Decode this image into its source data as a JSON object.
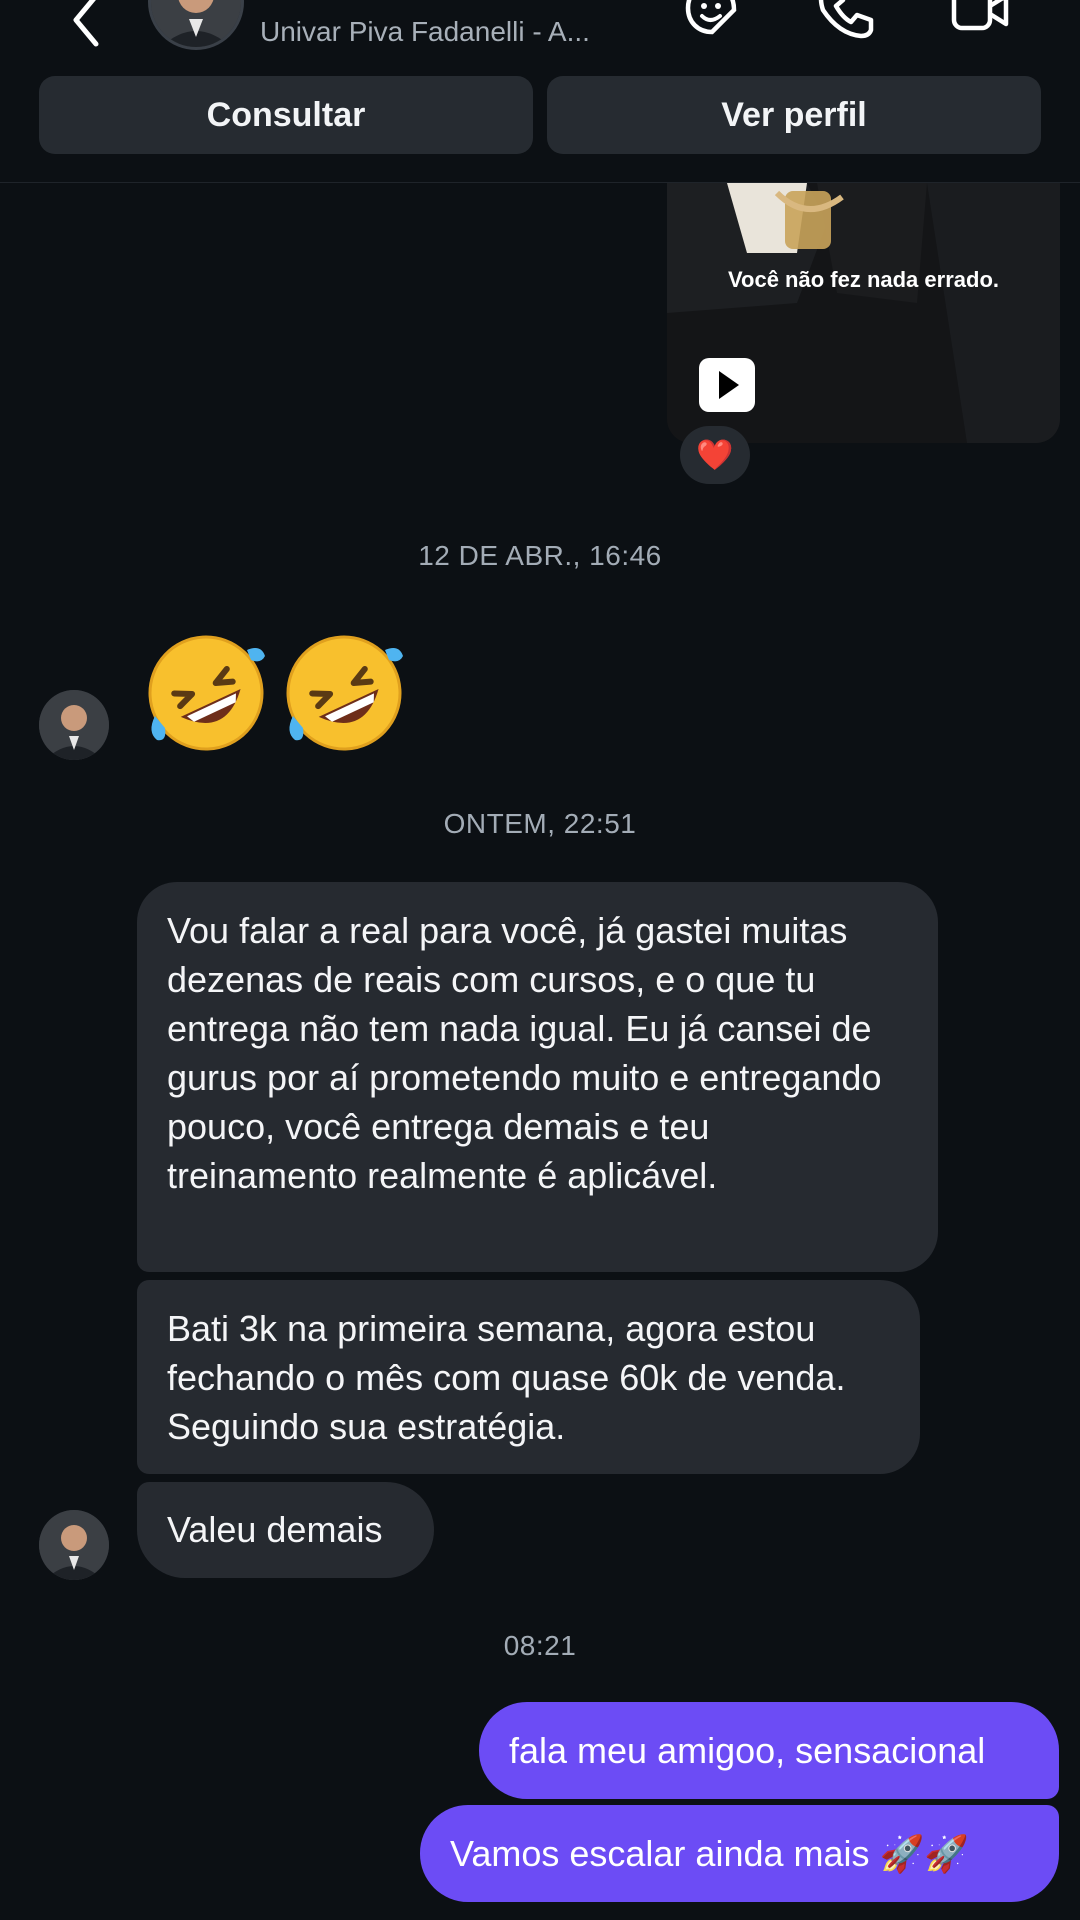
{
  "header": {
    "subtitle": "Univar Piva Fadanelli - A...",
    "buttons": {
      "consult": "Consultar",
      "profile": "Ver perfil"
    },
    "icons": [
      "back-chevron-icon",
      "sticker-icon",
      "phone-icon",
      "video-call-icon"
    ]
  },
  "video_message": {
    "caption": "Você não fez nada errado.",
    "reaction": "❤️"
  },
  "timestamps": {
    "first": "12 DE ABR., 16:46",
    "second": "ONTEM, 22:51",
    "third": "08:21"
  },
  "messages": {
    "incoming_1": "Vou falar a real para você, já gastei muitas dezenas de reais com cursos, e o que tu entrega não tem nada igual. Eu já cansei de gurus por aí prometendo muito e entregando pouco, você entrega demais e teu treinamento realmente é aplicável.",
    "incoming_2": "Bati 3k na primeira semana, agora estou fechando o mês com quase 60k de venda. Seguindo sua estratégia.",
    "incoming_3": "Valeu demais",
    "outgoing_1": "fala meu amigoo, sensacional",
    "outgoing_2": "Vamos escalar ainda mais 🚀🚀"
  },
  "colors": {
    "background": "#0c1014",
    "incoming_bubble": "#262a30",
    "outgoing_bubble": "#6c4cf5",
    "timestamp": "#a3acb6"
  }
}
